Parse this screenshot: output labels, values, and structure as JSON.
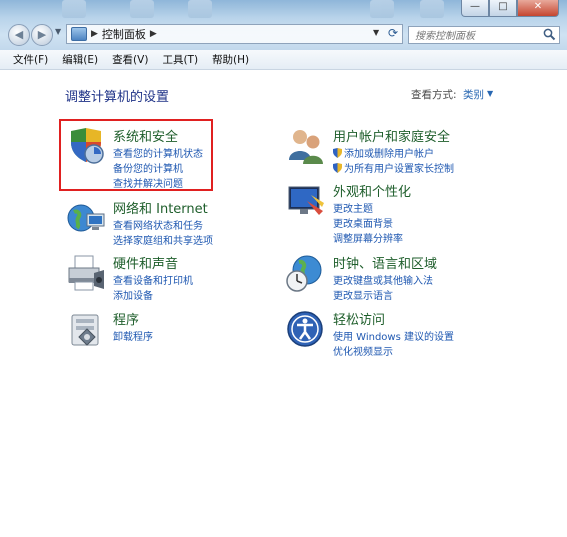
{
  "window": {
    "min_symbol": "—",
    "max_symbol": "□",
    "close_symbol": "✕"
  },
  "address_bar": {
    "crumb_separator": "▶",
    "breadcrumb": "控制面板",
    "trailing_separator": "▶"
  },
  "search": {
    "placeholder": "搜索控制面板"
  },
  "menubar": {
    "items": [
      "文件(F)",
      "编辑(E)",
      "查看(V)",
      "工具(T)",
      "帮助(H)"
    ]
  },
  "main": {
    "title": "调整计算机的设置",
    "view_by_label": "查看方式:",
    "view_by_value": "类别",
    "categories": [
      {
        "title": "系统和安全",
        "links": [
          "查看您的计算机状态",
          "备份您的计算机",
          "查找并解决问题"
        ]
      },
      {
        "title": "网络和 Internet",
        "links": [
          "查看网络状态和任务",
          "选择家庭组和共享选项"
        ]
      },
      {
        "title": "硬件和声音",
        "links": [
          "查看设备和打印机",
          "添加设备"
        ]
      },
      {
        "title": "程序",
        "links": [
          "卸载程序"
        ]
      },
      {
        "title": "用户帐户和家庭安全",
        "links": [
          "添加或删除用户帐户",
          "为所有用户设置家长控制"
        ]
      },
      {
        "title": "外观和个性化",
        "links": [
          "更改主题",
          "更改桌面背景",
          "调整屏幕分辨率"
        ]
      },
      {
        "title": "时钟、语言和区域",
        "links": [
          "更改键盘或其他输入法",
          "更改显示语言"
        ]
      },
      {
        "title": "轻松访问",
        "links": [
          "使用 Windows 建议的设置",
          "优化视频显示"
        ]
      }
    ]
  },
  "highlight": {
    "color": "#e02020"
  },
  "colors": {
    "link": "#1f58b1",
    "category_title": "#1e5e2b",
    "page_title": "#1e3287"
  }
}
